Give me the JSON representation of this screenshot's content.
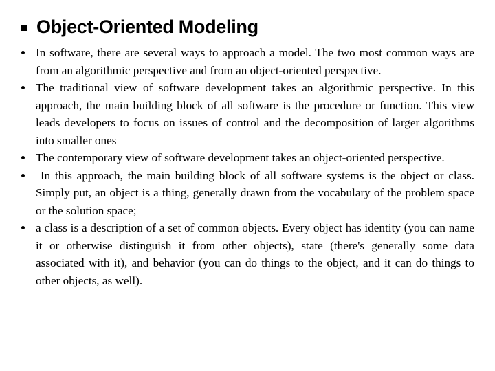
{
  "slide": {
    "title": "Object-Oriented Modeling",
    "bullets": [
      "In software, there are several ways to approach a model. The two most common ways are from an algorithmic perspective and from an object-oriented perspective.",
      "The traditional view of software development takes an algorithmic perspective. In this approach, the main building block of all software is the procedure or function. This view leads developers to focus on issues of control and the decomposition of larger algorithms into smaller ones",
      "The contemporary view of software development takes an object-oriented perspective.",
      " In this approach, the main building block of all software systems is the object or class. Simply put, an object is a thing, generally drawn from the vocabulary of the problem space or the solution space;",
      "a class is a description of a set of common objects. Every object has identity (you can name it or otherwise distinguish it from other objects), state (there's generally some data associated with it), and behavior (you can do things to the object, and it can do things to other objects, as well)."
    ]
  }
}
